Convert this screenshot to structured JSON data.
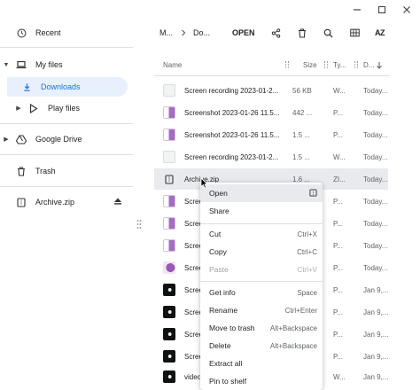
{
  "window": {
    "controls": [
      "minimize-icon",
      "maximize-icon",
      "close-icon"
    ]
  },
  "sidebar": {
    "recent": {
      "label": "Recent",
      "icon": "clock-icon"
    },
    "my_files": {
      "label": "My files",
      "icon": "laptop-icon"
    },
    "downloads": {
      "label": "Downloads",
      "icon": "download-icon"
    },
    "play_files": {
      "label": "Play files",
      "icon": "play-store-icon"
    },
    "google_drive": {
      "label": "Google Drive",
      "icon": "drive-icon"
    },
    "trash": {
      "label": "Trash",
      "icon": "trash-icon"
    },
    "archive": {
      "label": "Archive.zip",
      "icon": "zip-icon",
      "eject_icon": "eject-icon"
    }
  },
  "toolbar": {
    "breadcrumb": [
      "M...",
      "Do..."
    ],
    "open_label": "OPEN",
    "icons": [
      "share-icon",
      "delete-icon",
      "search-icon",
      "grid-view-icon",
      "sort-az-icon"
    ],
    "sort_label": "AZ"
  },
  "columns": {
    "name": "Name",
    "size": "Size",
    "type": "Ty...",
    "date": "D..."
  },
  "files": [
    {
      "name": "Screen recording 2023-01-2...",
      "size": "56 KB",
      "type": "W...",
      "date": "Today...",
      "thumb": "recording"
    },
    {
      "name": "Screenshot 2023-01-26 11.5...",
      "size": "442 ...",
      "type": "P...",
      "date": "Today...",
      "thumb": "shot"
    },
    {
      "name": "Screenshot 2023-01-26 11.5...",
      "size": "1.5 ...",
      "type": "P...",
      "date": "Today...",
      "thumb": "shot"
    },
    {
      "name": "Screen recording 2023-01-2...",
      "size": "1.5 ...",
      "type": "W...",
      "date": "Today...",
      "thumb": "recording"
    },
    {
      "name": "Archive.zip",
      "size": "1.6 ...",
      "type": "ZI...",
      "date": "Today...",
      "thumb": "zip"
    },
    {
      "name": "Scree",
      "size": "",
      "type": "P...",
      "date": "Today...",
      "thumb": "shot"
    },
    {
      "name": "Scree",
      "size": "",
      "type": "P...",
      "date": "Today...",
      "thumb": "shot"
    },
    {
      "name": "Scree",
      "size": "",
      "type": "P...",
      "date": "Today...",
      "thumb": "shot"
    },
    {
      "name": "Scree",
      "size": "",
      "type": "P...",
      "date": "Today...",
      "thumb": "shot2"
    },
    {
      "name": "Scree",
      "size": "",
      "type": "P...",
      "date": "Jan 9,...",
      "thumb": "dark"
    },
    {
      "name": "Scree",
      "size": "",
      "type": "P...",
      "date": "Jan 9,...",
      "thumb": "dark"
    },
    {
      "name": "Scree",
      "size": "",
      "type": "P...",
      "date": "Jan 9,...",
      "thumb": "dark"
    },
    {
      "name": "Scree",
      "size": "",
      "type": "P...",
      "date": "Jan 9,...",
      "thumb": "dark"
    },
    {
      "name": "Scree",
      "size": "",
      "type": "P...",
      "date": "Jan 9,...",
      "thumb": "dark"
    },
    {
      "name": "video",
      "size": "",
      "type": "W...",
      "date": "Jan 9,...",
      "thumb": "dark"
    }
  ],
  "context_menu": {
    "open": {
      "label": "Open",
      "icon": "open-with-icon"
    },
    "share": {
      "label": "Share"
    },
    "cut": {
      "label": "Cut",
      "shortcut": "Ctrl+X"
    },
    "copy": {
      "label": "Copy",
      "shortcut": "Ctrl+C"
    },
    "paste": {
      "label": "Paste",
      "shortcut": "Ctrl+V"
    },
    "get_info": {
      "label": "Get info",
      "shortcut": "Space"
    },
    "rename": {
      "label": "Rename",
      "shortcut": "Ctrl+Enter"
    },
    "move_to_trash": {
      "label": "Move to trash",
      "shortcut": "Alt+Backspace"
    },
    "delete": {
      "label": "Delete",
      "shortcut": "Alt+Backspace"
    },
    "extract_all": {
      "label": "Extract all"
    },
    "pin_to_shelf": {
      "label": "Pin to shelf"
    }
  },
  "colors": {
    "accent": "#1a73e8",
    "selected_nav_bg": "#e8f0fe",
    "selected_row_bg": "#e8eaed"
  }
}
